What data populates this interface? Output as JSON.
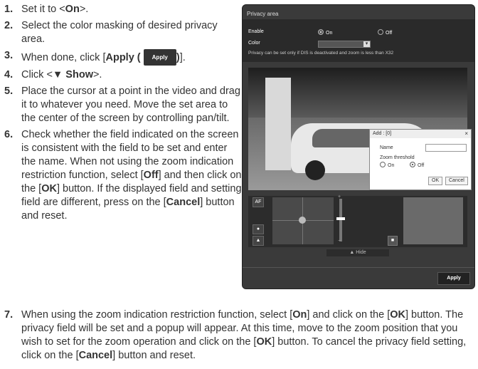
{
  "steps": [
    {
      "num": "1.",
      "pre": "Set it to <",
      "bold": "On",
      "post": ">."
    },
    {
      "num": "2.",
      "text": "Select the color masking of desired privacy area."
    },
    {
      "num": "3.",
      "pre": "When done, click [",
      "bold": "Apply (",
      "chip": "Apply",
      "bold2": ")",
      "post": "]."
    },
    {
      "num": "4.",
      "pre": "Click <",
      "bold": "▼ Show",
      "post": ">."
    },
    {
      "num": "5.",
      "text": "Place the cursor at a point in the video and drag it to whatever you need. Move the set area to the center of the screen by controlling pan/tilt."
    },
    {
      "num": "6.",
      "t1": "Check whether the field indicated on the screen is consistent with the field to be set and enter the name. When not using the zoom indication restriction function, select [",
      "b1": "Off",
      "t2": "] and then click on the [",
      "b2": "OK",
      "t3": "] button. If the displayed field and setting field are different, press on the [",
      "b3": "Cancel",
      "t4": "] button and reset."
    },
    {
      "num": "7.",
      "t1": "When using the zoom indication restriction function, select [",
      "b1": "On",
      "t2": "] and click on the [",
      "b2": "OK",
      "t3": "] button. The privacy field will be set and a popup will appear. At this time, move to the zoom position that you wish to set for the zoom operation and click on the [",
      "b3": "OK",
      "t4": "] button. To cancel the privacy field setting, click on the [",
      "b4": "Cancel",
      "t5": "] button and reset."
    }
  ],
  "panel": {
    "title": "Privacy area",
    "enable_label": "Enable",
    "enable_on": "On",
    "enable_off": "Off",
    "enable_selected": "On",
    "color_label": "Color",
    "note": "Privacy can be set only if DIS is deactivated and zoom is less than X32",
    "dialog": {
      "title": "Add : [0]",
      "name_label": "Name",
      "name_value": "",
      "zoom_label": "Zoom threshold",
      "zoom_on": "On",
      "zoom_off": "Off",
      "zoom_selected": "Off",
      "ok": "OK",
      "cancel": "Cancel"
    },
    "af_label": "AF",
    "hide_label": "▲ Hide",
    "apply_label": "Apply"
  },
  "icons": {
    "person": "person-icon",
    "mountain": "mountain-icon",
    "trash": "trash-icon",
    "close": "close-icon",
    "dropdown": "chevron-down-icon"
  }
}
